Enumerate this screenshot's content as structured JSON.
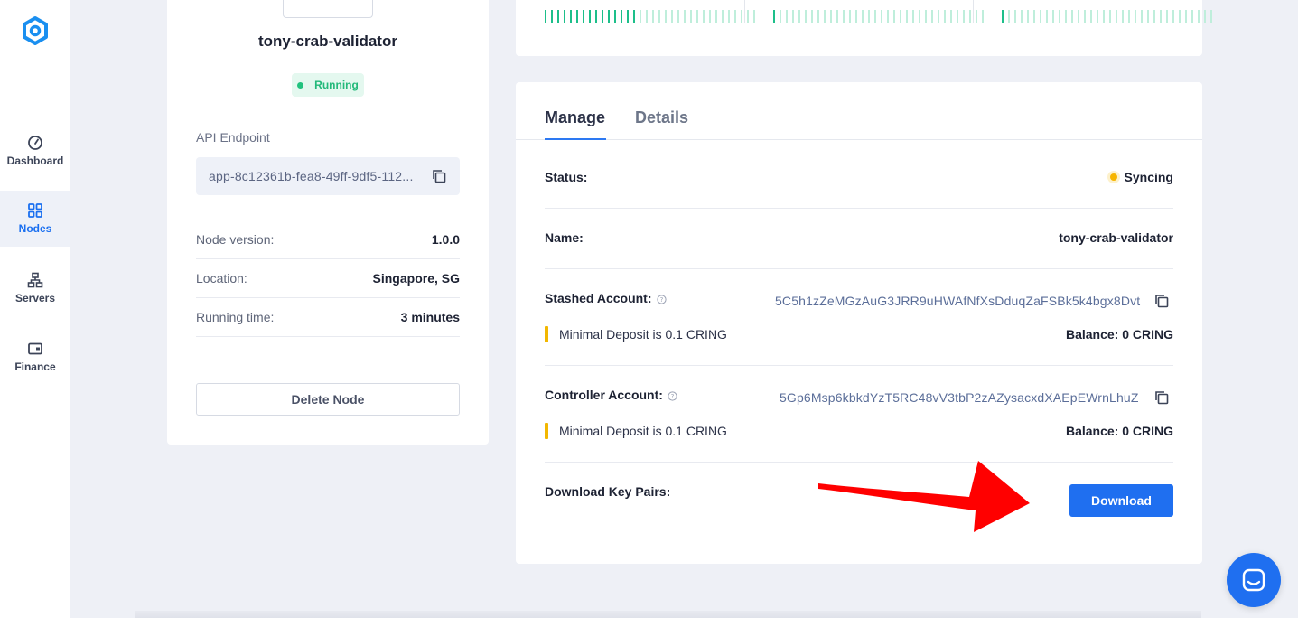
{
  "sidebar": {
    "logo_icon": "logo-hexagon-icon",
    "items": [
      {
        "label": "Dashboard",
        "icon": "gauge-icon",
        "active": false
      },
      {
        "label": "Nodes",
        "icon": "grid-icon",
        "active": true
      },
      {
        "label": "Servers",
        "icon": "network-icon",
        "active": false
      },
      {
        "label": "Finance",
        "icon": "wallet-icon",
        "active": false
      }
    ]
  },
  "node": {
    "name": "tony-crab-validator",
    "status": "Running",
    "api_endpoint_label": "API Endpoint",
    "api_endpoint_value": "app-8c12361b-fea8-49ff-9df5-112...",
    "info": [
      {
        "key": "Node version:",
        "value": "1.0.0"
      },
      {
        "key": "Location:",
        "value": "Singapore, SG"
      },
      {
        "key": "Running time:",
        "value": "3 minutes"
      }
    ],
    "delete_label": "Delete Node"
  },
  "manage": {
    "tabs": [
      {
        "label": "Manage",
        "active": true
      },
      {
        "label": "Details",
        "active": false
      }
    ],
    "status_label": "Status:",
    "status_value": "Syncing",
    "name_label": "Name:",
    "name_value": "tony-crab-validator",
    "stash_label": "Stashed Account:",
    "stash_address": "5C5h1zZeMGzAuG3JRR9uHWAfNfXsDduqZaFSBk5k4bgx8Dvt",
    "stash_deposit": "Minimal Deposit is 0.1 CRING",
    "stash_balance": "Balance: 0 CRING",
    "controller_label": "Controller Account:",
    "controller_address": "5Gp6Msp6kbkdYzT5RC48vV3tbP2zAZysacxdXAEpEWrnLhuZ",
    "controller_deposit": "Minimal Deposit is 0.1 CRING",
    "controller_balance": "Balance: 0 CRING",
    "download_label": "Download Key Pairs:",
    "download_button": "Download"
  },
  "colors": {
    "accent": "#1f6ff0",
    "running_green": "#22b97a",
    "syncing_yellow": "#f7b500",
    "deposit_bar": "#f2b701",
    "arrow_red": "#ff0000"
  },
  "activity_bars": [
    {
      "filled": 15,
      "total": 34
    },
    {
      "filled": 1,
      "total": 34
    },
    {
      "filled": 1,
      "total": 34
    }
  ]
}
